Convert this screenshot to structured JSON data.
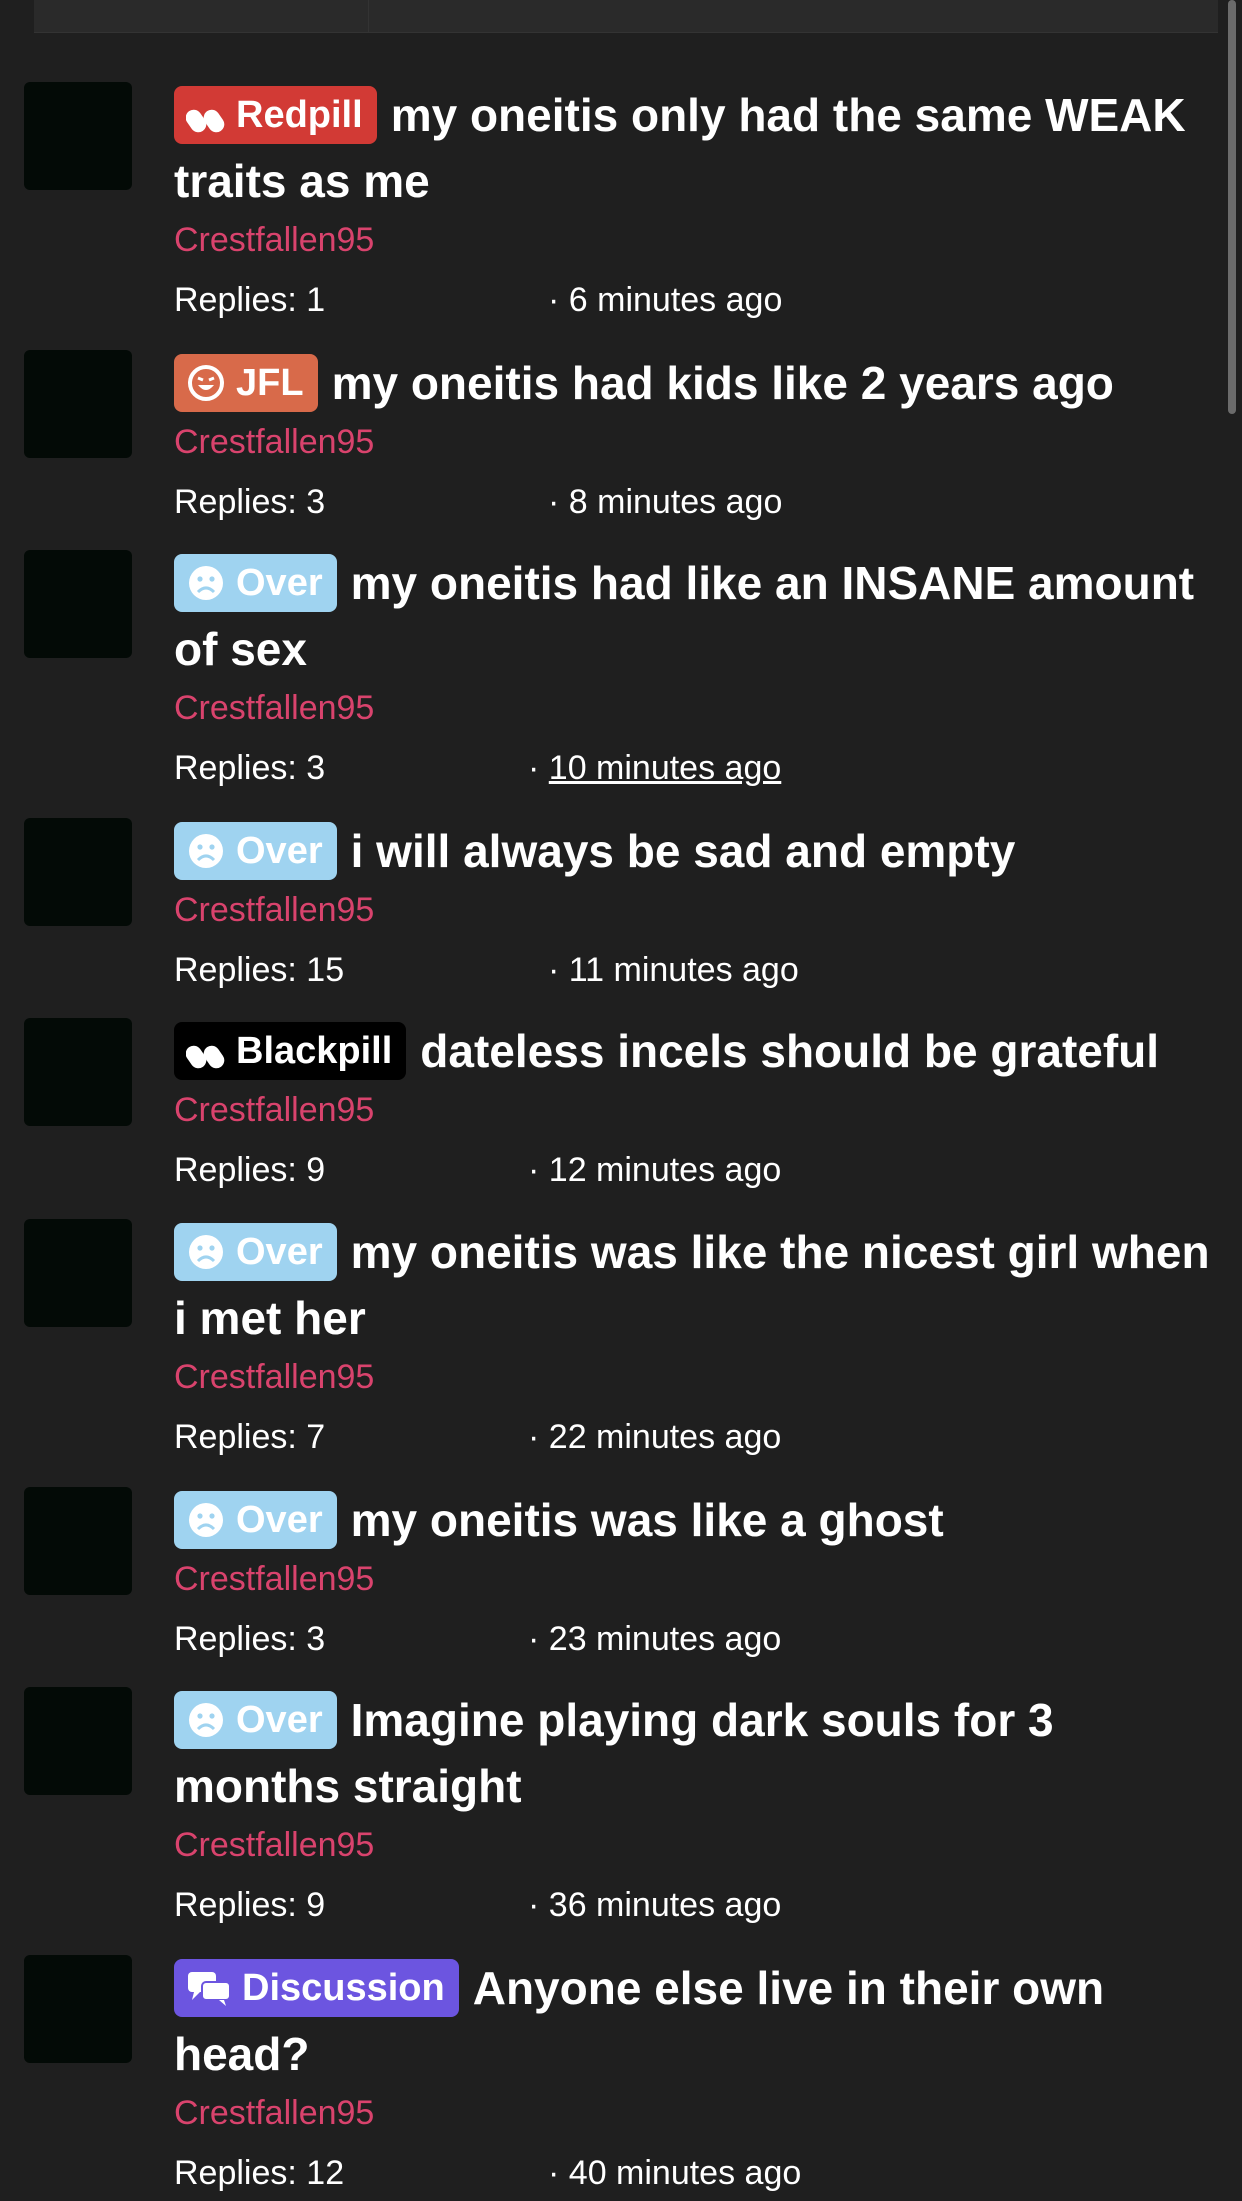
{
  "threads": [
    {
      "prefix": "Redpill",
      "prefix_style": "red",
      "prefix_icon": "pill-icon",
      "title": "my oneitis only had the same WEAK traits as me",
      "author": "Crestfallen95",
      "replies": "Replies: 1",
      "time": "6 minutes ago"
    },
    {
      "prefix": "JFL",
      "prefix_style": "orange",
      "prefix_icon": "laugh-icon",
      "title": "my oneitis had kids like 2 years ago",
      "author": "Crestfallen95",
      "replies": "Replies: 3",
      "time": "8 minutes ago"
    },
    {
      "prefix": "Over",
      "prefix_style": "blue",
      "prefix_icon": "sad-face-icon",
      "title": "my oneitis had like an INSANE amount of sex",
      "author": "Crestfallen95",
      "replies": "Replies: 3",
      "time": "10 minutes ago"
    },
    {
      "prefix": "Over",
      "prefix_style": "blue",
      "prefix_icon": "sad-face-icon",
      "title": "i will always be sad and empty",
      "author": "Crestfallen95",
      "replies": "Replies: 15",
      "time": "11 minutes ago"
    },
    {
      "prefix": "Blackpill",
      "prefix_style": "black",
      "prefix_icon": "pill-icon",
      "title": "dateless incels should be grateful",
      "author": "Crestfallen95",
      "replies": "Replies: 9",
      "time": "12 minutes ago"
    },
    {
      "prefix": "Over",
      "prefix_style": "blue",
      "prefix_icon": "sad-face-icon",
      "title": "my oneitis was like the nicest girl when i met her",
      "author": "Crestfallen95",
      "replies": "Replies: 7",
      "time": "22 minutes ago"
    },
    {
      "prefix": "Over",
      "prefix_style": "blue",
      "prefix_icon": "sad-face-icon",
      "title": "my oneitis was like a ghost",
      "author": "Crestfallen95",
      "replies": "Replies: 3",
      "time": "23 minutes ago"
    },
    {
      "prefix": "Over",
      "prefix_style": "blue",
      "prefix_icon": "sad-face-icon",
      "title": "Imagine playing dark souls for 3 months straight",
      "author": "Crestfallen95",
      "replies": "Replies: 9",
      "time": "36 minutes ago"
    },
    {
      "prefix": "Discussion",
      "prefix_style": "purple",
      "prefix_icon": "chat-bubbles-icon",
      "title": "Anyone else live in their own head?",
      "author": "Crestfallen95",
      "replies": "Replies: 12",
      "time": "40 minutes ago"
    }
  ],
  "colors": {
    "background": "#1f1f1f",
    "author": "#d9436d",
    "redpill": "#d23a35",
    "jfl": "#d86a4a",
    "over": "#9fd3f0",
    "blackpill": "#000000",
    "discussion": "#6c55e0"
  }
}
